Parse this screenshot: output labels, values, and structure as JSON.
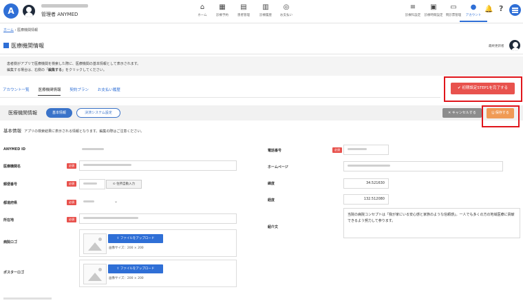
{
  "header": {
    "logo_letter": "A",
    "admin_label": "管理者  ANYMED",
    "nav": [
      {
        "label": "ホーム",
        "icon": "home-icon",
        "glyph": "⌂"
      },
      {
        "label": "診療予約",
        "icon": "calendar-icon",
        "glyph": "▦"
      },
      {
        "label": "患者管理",
        "icon": "patients-icon",
        "glyph": "▤"
      },
      {
        "label": "診療履歴",
        "icon": "history-icon",
        "glyph": "▥"
      },
      {
        "label": "お支払い",
        "icon": "payment-icon",
        "glyph": "◎"
      }
    ],
    "right_nav": [
      {
        "label": "診療科設定",
        "icon": "settings-list-icon",
        "glyph": "≡"
      },
      {
        "label": "診療時間設定",
        "icon": "schedule-icon",
        "glyph": "▣"
      },
      {
        "label": "問診票管理",
        "icon": "folder-icon",
        "glyph": "▭"
      },
      {
        "label": "アカウント",
        "icon": "account-icon",
        "glyph": "●",
        "active": true
      }
    ],
    "bell_glyph": "🔔",
    "help_glyph": "?"
  },
  "breadcrumb": {
    "home": "ホーム",
    "sep": " › ",
    "current": "医療機関情報"
  },
  "page": {
    "title": "医療機関情報",
    "editor_label": "最終更新者",
    "notice_line1": "患者側がアプリで医療機関を検索した際に、医療機関の基本情報として表示されます。",
    "notice_line2_pre": "編集する場合は、右側の「",
    "notice_line2_bold": "編集する",
    "notice_line2_post": "」をクリックしてください。"
  },
  "tabs": [
    {
      "label": "アカウント一覧",
      "active": false
    },
    {
      "label": "医療機関情報",
      "active": true
    },
    {
      "label": "契約プラン",
      "active": false
    },
    {
      "label": "お支払い履歴",
      "active": false
    }
  ],
  "actions": {
    "complete_step": "✔  初期設定STEP1を完了する",
    "cancel": "✕ キャンセルする",
    "save": "🖫 保存する"
  },
  "section": {
    "title": "医療機関情報",
    "pill_basic": "基本情報",
    "pill_payment": "決済システム設定"
  },
  "basic": {
    "heading": "基本情報",
    "sub": "アプリの検索結果に表示される情報となります。編集の際はご注意ください。"
  },
  "form": {
    "required": "必須",
    "anymed_id": "ANYMED ID",
    "name": "医療機関名",
    "postal": "郵便番号",
    "addr_button": "⊙ 住所自動入力",
    "prefecture": "都道府県",
    "chevron": "⌄",
    "address": "所在地",
    "logo": "病院ロゴ",
    "poster": "ポスターロゴ",
    "upload_label": "⇪ ファイルをアップロード",
    "img_size": "画像サイズ：200 × 200",
    "phone": "電話番号",
    "homepage": "ホームページ",
    "latitude": "緯度",
    "latitude_value": "34.521630",
    "longitude": "経度",
    "longitude_value": "132.512080",
    "intro": "紹介文",
    "intro_value": "当院の病院コンセプトは「我が家にいる安心感と家族のような信頼感」。一人でも多くの方の地域医療に貢献できるよう努力して参ります。"
  }
}
